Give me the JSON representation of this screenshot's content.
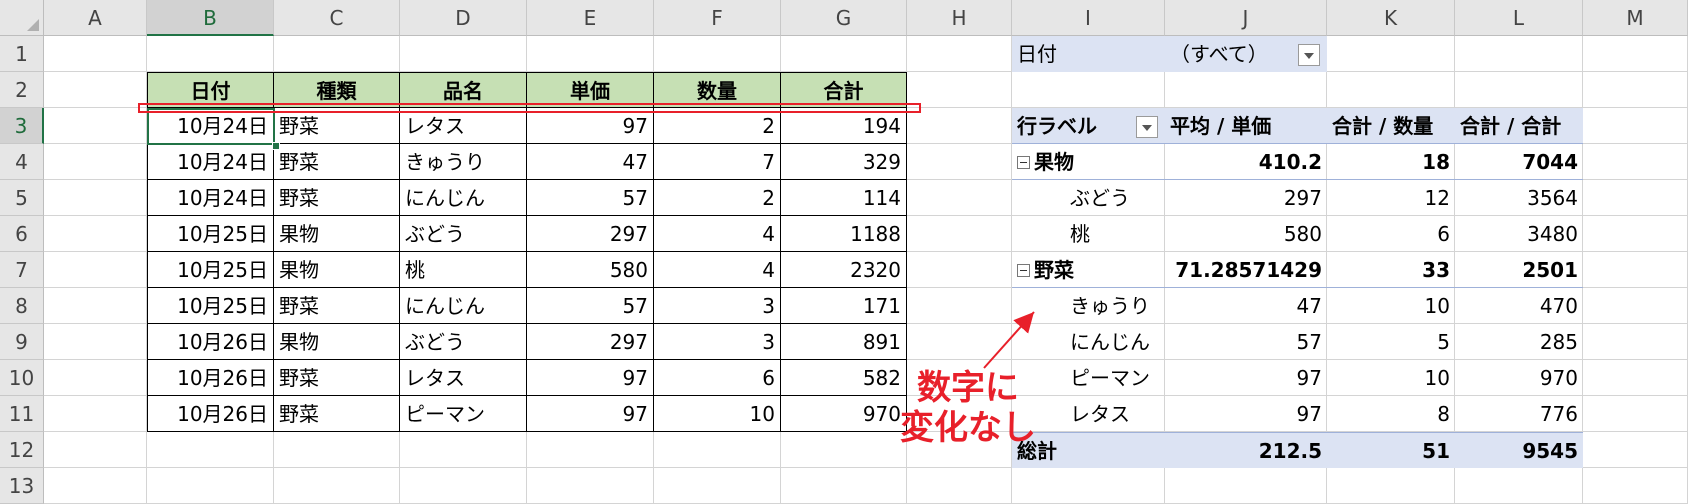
{
  "columns": [
    "A",
    "B",
    "C",
    "D",
    "E",
    "F",
    "G",
    "H",
    "I",
    "J",
    "K",
    "L",
    "M"
  ],
  "rows": [
    "1",
    "2",
    "3",
    "4",
    "5",
    "6",
    "7",
    "8",
    "9",
    "10",
    "11",
    "12",
    "13"
  ],
  "selected_cell": {
    "column": "B",
    "row": "3"
  },
  "table": {
    "headers": [
      "日付",
      "種類",
      "品名",
      "単価",
      "数量",
      "合計"
    ],
    "rows": [
      [
        "10月24日",
        "野菜",
        "レタス",
        "97",
        "2",
        "194"
      ],
      [
        "10月24日",
        "野菜",
        "きゅうり",
        "47",
        "7",
        "329"
      ],
      [
        "10月24日",
        "野菜",
        "にんじん",
        "57",
        "2",
        "114"
      ],
      [
        "10月25日",
        "果物",
        "ぶどう",
        "297",
        "4",
        "1188"
      ],
      [
        "10月25日",
        "果物",
        "桃",
        "580",
        "4",
        "2320"
      ],
      [
        "10月25日",
        "野菜",
        "にんじん",
        "57",
        "3",
        "171"
      ],
      [
        "10月26日",
        "果物",
        "ぶどう",
        "297",
        "3",
        "891"
      ],
      [
        "10月26日",
        "野菜",
        "レタス",
        "97",
        "6",
        "582"
      ],
      [
        "10月26日",
        "野菜",
        "ピーマン",
        "97",
        "10",
        "970"
      ]
    ]
  },
  "pivot": {
    "filter_label": "日付",
    "filter_value": "（すべて）",
    "row_label_header": "行ラベル",
    "value_headers": [
      "平均 / 単価",
      "合計 / 数量",
      "合計 / 合計"
    ],
    "groups": [
      {
        "name": "果物",
        "values": [
          "410.2",
          "18",
          "7044"
        ],
        "items": [
          [
            "ぶどう",
            "297",
            "12",
            "3564"
          ],
          [
            "桃",
            "580",
            "6",
            "3480"
          ]
        ]
      },
      {
        "name": "野菜",
        "values": [
          "71.28571429",
          "33",
          "2501"
        ],
        "items": [
          [
            "きゅうり",
            "47",
            "10",
            "470"
          ],
          [
            "にんじん",
            "57",
            "5",
            "285"
          ],
          [
            "ピーマン",
            "97",
            "10",
            "970"
          ],
          [
            "レタス",
            "97",
            "8",
            "776"
          ]
        ]
      }
    ],
    "total_label": "総計",
    "total_values": [
      "212.5",
      "51",
      "9545"
    ]
  },
  "annotation": {
    "line1": "数字に",
    "line2": "変化なし"
  },
  "colors": {
    "header_green": "#c6e0b4",
    "pivot_blue": "#dce3f3",
    "annotation_red": "#e8202a",
    "selection_green": "#217346"
  }
}
